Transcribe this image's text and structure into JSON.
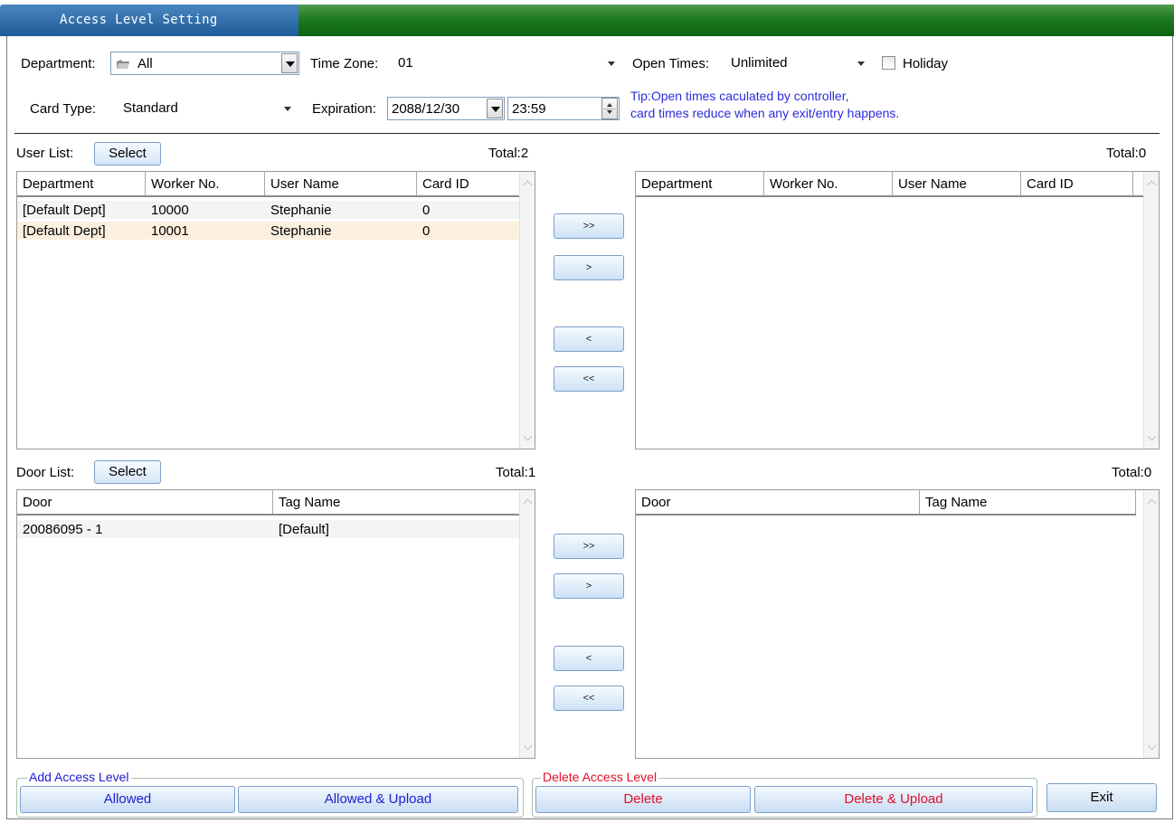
{
  "window": {
    "title": "Access Level Setting"
  },
  "filters": {
    "department_label": "Department:",
    "department_value": "All",
    "time_zone_label": "Time Zone:",
    "time_zone_value": "01",
    "open_times_label": "Open Times:",
    "open_times_value": "Unlimited",
    "holiday_label": "Holiday",
    "card_type_label": "Card Type:",
    "card_type_value": "Standard",
    "expiration_label": "Expiration:",
    "expiration_date": "2088/12/30",
    "expiration_time": "23:59",
    "tip_line1": "Tip:Open times caculated by controller,",
    "tip_line2": "card times reduce when any exit/entry happens."
  },
  "user_list": {
    "label": "User List:",
    "select_label": "Select",
    "total": "Total:2",
    "columns": [
      "Department",
      "Worker No.",
      "User Name",
      "Card ID"
    ],
    "rows": [
      [
        "[Default Dept]",
        "10000",
        "Stephanie",
        "0"
      ],
      [
        "[Default Dept]",
        "10001",
        "Stephanie",
        "0"
      ]
    ]
  },
  "user_selected": {
    "total": "Total:0",
    "columns": [
      "Department",
      "Worker No.",
      "User Name",
      "Card ID"
    ]
  },
  "door_list": {
    "label": "Door List:",
    "select_label": "Select",
    "total": "Total:1",
    "columns": [
      "Door",
      "Tag Name"
    ],
    "rows": [
      [
        "20086095 - 1",
        "[Default]"
      ]
    ]
  },
  "door_selected": {
    "total": "Total:0",
    "columns": [
      "Door",
      "Tag Name"
    ]
  },
  "move_buttons": {
    "add_all": ">>",
    "add_one": ">",
    "remove_one": "<",
    "remove_all": "<<"
  },
  "actions": {
    "add_group_label": "Add Access Level",
    "allowed": "Allowed",
    "allowed_upload": "Allowed & Upload",
    "delete_group_label": "Delete Access Level",
    "delete": "Delete",
    "delete_upload": "Delete & Upload",
    "exit": "Exit"
  },
  "colors": {
    "title_blue": "#1f5c97",
    "title_green": "#0a6410",
    "tip_text": "#2b2bdc",
    "add_text": "#1d1dcf",
    "delete_text": "#e0102a",
    "row_highlight": "#fdefde"
  },
  "icons": {
    "department_icon": "folder-icon"
  }
}
